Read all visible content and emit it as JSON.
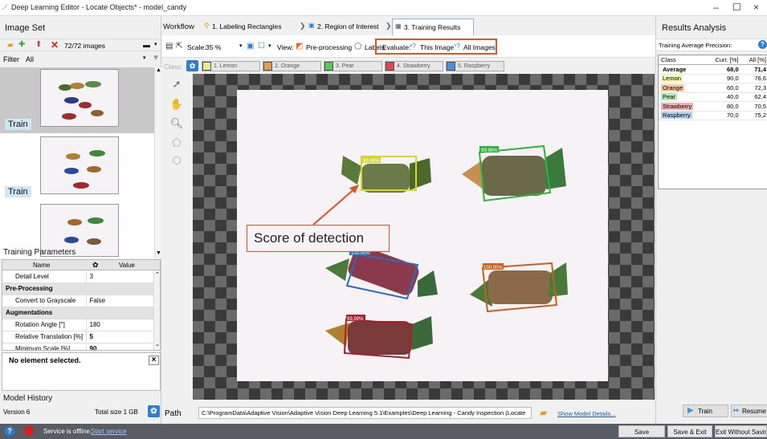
{
  "window": {
    "title": "Deep Learning Editor - Locate Objects* - model_candy",
    "minimize": "–",
    "maximize": "☐",
    "close": "×"
  },
  "left": {
    "header": "Image Set",
    "count": "72/72 images",
    "filter_label": "Filter",
    "filter_value": "All",
    "thumbnails": [
      {
        "label": "Train"
      },
      {
        "label": "Train"
      },
      {
        "label": ""
      }
    ],
    "params_header": "Training Parameters",
    "params_columns": [
      "Name",
      "Value"
    ],
    "params": [
      {
        "name": "Detail Level",
        "value": "3",
        "section": false,
        "bold": false
      },
      {
        "name": "Pre-Processing",
        "value": "",
        "section": true,
        "bold": false
      },
      {
        "name": "Convert to Grayscale",
        "value": "False",
        "section": false,
        "bold": false
      },
      {
        "name": "Augmentations",
        "value": "",
        "section": true,
        "bold": false
      },
      {
        "name": "Rotation Angle [°]",
        "value": "180",
        "section": false,
        "bold": false
      },
      {
        "name": "Relative Translation [%]",
        "value": "5",
        "section": false,
        "bold": true
      },
      {
        "name": "Minimum Scale [%]",
        "value": "90",
        "section": false,
        "bold": true
      }
    ],
    "no_selection": "No element selected.",
    "history_header": "Model History",
    "version": "Version 6",
    "total_size": "Total size 1 GB"
  },
  "workflow": {
    "label": "Workflow",
    "steps": [
      "1. Labeling Rectangles",
      "2. Region of Interest",
      "3. Training Results"
    ],
    "scale_label": "Scale:",
    "scale_value": "35 %",
    "view_label": "View:",
    "preprocessing": "Pre-processing",
    "labels": "Labels",
    "evaluate_label": "Evaluate:",
    "this_image": "This Image",
    "all_images": "All Images"
  },
  "classes": {
    "label": "Class:",
    "items": [
      {
        "name": "1. Lemon",
        "color": "#e8ec8a"
      },
      {
        "name": "2. Orange",
        "color": "#e89a52"
      },
      {
        "name": "3. Pear",
        "color": "#4fcf4f"
      },
      {
        "name": "4. Strawberry",
        "color": "#e04850"
      },
      {
        "name": "5. Raspberry",
        "color": "#4a90e2"
      }
    ]
  },
  "canvas": {
    "annotation": "Score of detection",
    "scores": [
      "99.99%",
      "99.98%",
      "100.00%",
      "100.00%",
      "99.99%"
    ]
  },
  "path": {
    "label": "Path",
    "value": "C:\\ProgramData\\Adaptive Vision\\Adaptive Vision Deep Learning 5.1\\Examples\\Deep Learning - Candy Inspection (Locate",
    "details": "Show Model Details..."
  },
  "results": {
    "header": "Results Analysis",
    "subtitle": "Training Average Precision:",
    "help": "?",
    "columns": [
      "Class",
      "Curr. [%]",
      "All [%]"
    ],
    "rows": [
      {
        "name": "Average",
        "curr": "68,0",
        "all": "71,4",
        "color": "",
        "bold": true
      },
      {
        "name": "Lemon",
        "curr": "90,0",
        "all": "76,6",
        "color": "#f3f5b0",
        "bold": false
      },
      {
        "name": "Orange",
        "curr": "60,0",
        "all": "72,3",
        "color": "#f4c89c",
        "bold": false
      },
      {
        "name": "Pear",
        "curr": "40,0",
        "all": "62,4",
        "color": "#b7ebb4",
        "bold": false
      },
      {
        "name": "Strawberry",
        "curr": "80,0",
        "all": "70,5",
        "color": "#f2aeb1",
        "bold": false
      },
      {
        "name": "Raspberry",
        "curr": "70,0",
        "all": "75,2",
        "color": "#b4d2f1",
        "bold": false
      }
    ],
    "train": "Train",
    "resume": "Resume"
  },
  "status": {
    "offline": "Service is offline.",
    "start": "Start service",
    "save": "Save",
    "save_exit": "Save & Exit",
    "exit_nosave": "Exit Without Saving"
  }
}
